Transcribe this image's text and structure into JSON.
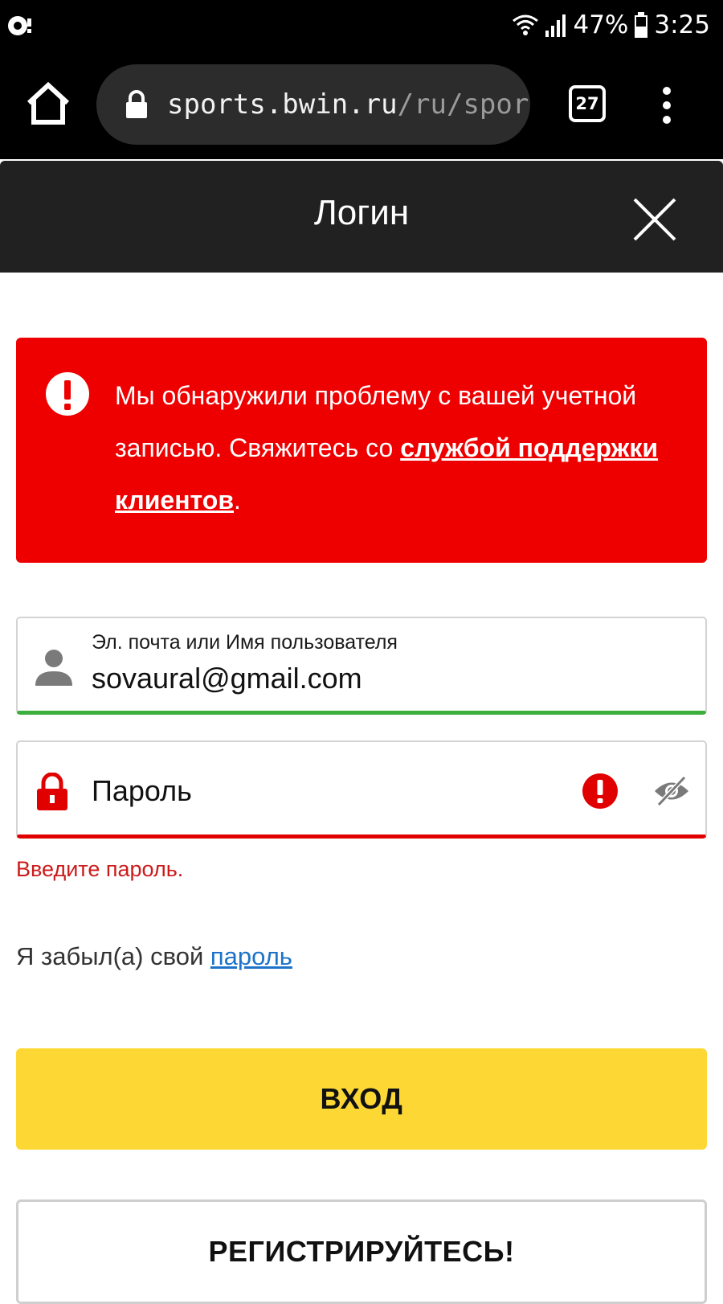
{
  "status_bar": {
    "battery_percent": "47%",
    "time": "3:25"
  },
  "browser": {
    "url_domain": "sports.bwin.ru",
    "url_path": "/ru/sport",
    "tab_count": "27"
  },
  "modal": {
    "title": "Логин"
  },
  "error_banner": {
    "text_before_link": "Мы обнаружили проблему с вашей учетной записью. Свяжитесь со ",
    "link_text": "службой поддержки клиентов",
    "text_after_link": "."
  },
  "form": {
    "email_label": "Эл. почта или Имя пользователя",
    "email_value": "sovaural@gmail.com",
    "password_placeholder": "Пароль",
    "password_error": "Введите пароль.",
    "forgot_prefix": "Я забыл(а) свой ",
    "forgot_link": "пароль"
  },
  "buttons": {
    "login": "ВХОД",
    "register": "РЕГИСТРИРУЙТЕСЬ!"
  },
  "colors": {
    "error_red": "#ee0000",
    "success_green": "#3cae3c",
    "login_yellow": "#fdd835",
    "link_blue": "#1e73c9",
    "header_dark": "#212121"
  }
}
